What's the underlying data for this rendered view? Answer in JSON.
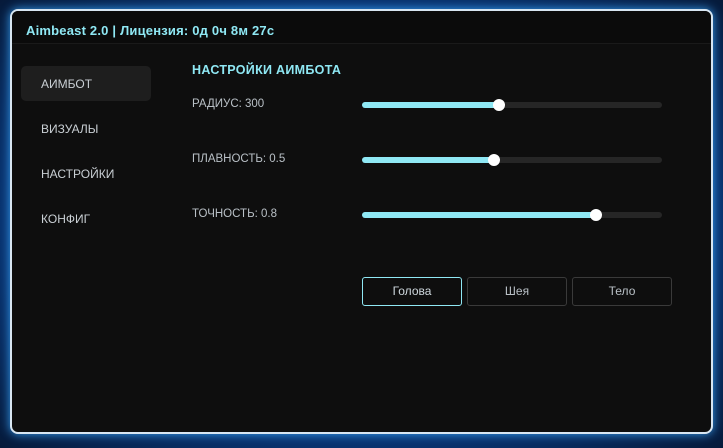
{
  "window": {
    "title": "Aimbeast 2.0 | Лицензия: 0д 0ч 8м 27с"
  },
  "sidebar": {
    "items": [
      {
        "label": "АИМБОТ",
        "active": true
      },
      {
        "label": "ВИЗУАЛЫ",
        "active": false
      },
      {
        "label": "НАСТРОЙКИ",
        "active": false
      },
      {
        "label": "КОНФИГ",
        "active": false
      }
    ]
  },
  "main": {
    "section_title": "НАСТРОЙКИ АИМБОТА",
    "sliders": [
      {
        "label": "РАДИУС: 300",
        "fraction": 0.455
      },
      {
        "label": "ПЛАВНОСТЬ: 0.5",
        "fraction": 0.44
      },
      {
        "label": "ТОЧНОСТЬ: 0.8",
        "fraction": 0.78
      }
    ],
    "target_buttons": [
      {
        "label": "Голова",
        "active": true
      },
      {
        "label": "Шея",
        "active": false
      },
      {
        "label": "Тело",
        "active": false
      }
    ]
  },
  "colors": {
    "accent": "#8fe8f4",
    "background": "#0e0e0e",
    "frame_glow": "#0b5fc4"
  }
}
